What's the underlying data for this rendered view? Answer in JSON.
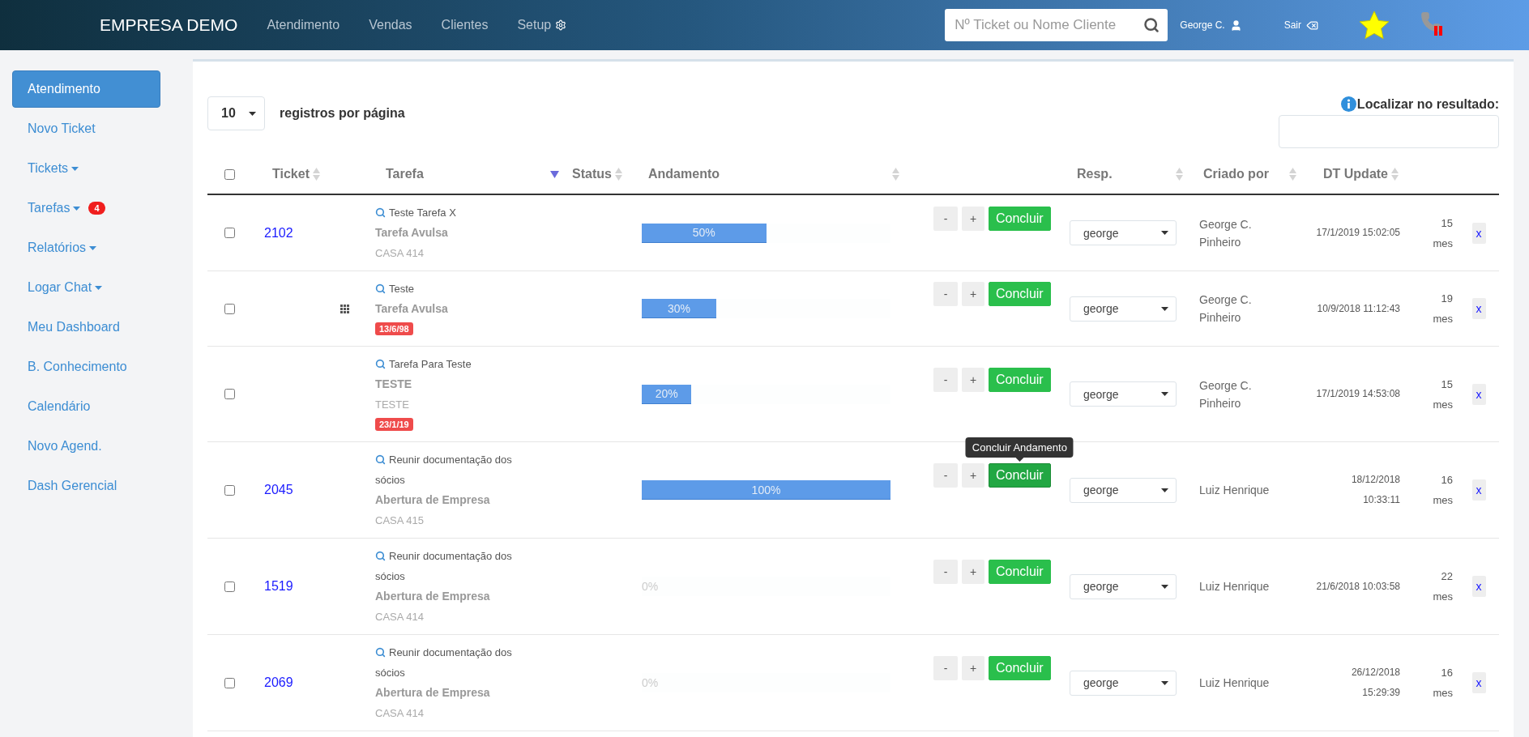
{
  "header": {
    "brand": "EMPRESA DEMO",
    "nav": [
      {
        "label": "Atendimento",
        "kind": "link"
      },
      {
        "label": "Vendas",
        "kind": "link"
      },
      {
        "label": "Clientes",
        "kind": "link"
      },
      {
        "label": "Setup",
        "kind": "settings"
      }
    ],
    "search": {
      "placeholder": "Nº Ticket ou Nome Cliente"
    },
    "user": "George C.",
    "logout": "Sair"
  },
  "sidebar": {
    "items": [
      {
        "label": "Atendimento",
        "selected": true,
        "dropdown": false
      },
      {
        "label": "Novo Ticket",
        "selected": false,
        "dropdown": false
      },
      {
        "label": "Tickets",
        "selected": false,
        "dropdown": true
      },
      {
        "label": "Tarefas",
        "selected": false,
        "dropdown": true,
        "badge": "4"
      },
      {
        "label": "Relatórios",
        "selected": false,
        "dropdown": true
      },
      {
        "label": "Logar Chat",
        "selected": false,
        "dropdown": true
      },
      {
        "label": "Meu Dashboard",
        "selected": false,
        "dropdown": false
      },
      {
        "label": "B. Conhecimento",
        "selected": false,
        "dropdown": false
      },
      {
        "label": "Calendário",
        "selected": false,
        "dropdown": false
      },
      {
        "label": "Novo Agend.",
        "selected": false,
        "dropdown": false
      },
      {
        "label": "Dash Gerencial",
        "selected": false,
        "dropdown": false
      }
    ]
  },
  "toolbar": {
    "page_size": "10",
    "page_size_label": "registros por página",
    "search_label": "Localizar no resultado:"
  },
  "table": {
    "columns": [
      {
        "kind": "checkbox",
        "checked": false
      },
      {
        "kind": "text",
        "label": "Ticket",
        "sorted": false
      },
      {
        "kind": "text",
        "label": "Tarefa",
        "sorted": true
      },
      {
        "kind": "text",
        "label": "Status",
        "sorted": false
      },
      {
        "kind": "text",
        "label": "Andamento",
        "sorted": false
      },
      {
        "kind": "text",
        "label": "Resp.",
        "sorted": false
      },
      {
        "kind": "text",
        "label": "Criado por",
        "sorted": false
      },
      {
        "kind": "text",
        "label": "DT Update",
        "sorted": false
      }
    ],
    "rows": [
      {
        "checked": false,
        "ticket": "2102",
        "menu": false,
        "task": {
          "title": "Teste Tarefa X",
          "type": "Tarefa Avulsa",
          "detail": "CASA 414"
        },
        "level": 0.5,
        "progress": "50%",
        "actions": [
          {
            "kind": "minus",
            "label": "-"
          },
          {
            "kind": "plus",
            "label": "+"
          },
          {
            "kind": "done",
            "label": "Concluir"
          }
        ],
        "resp": "george",
        "created_by": "George C. Pinheiro",
        "dt_update": [
          "17/1/2019 15:02:05"
        ],
        "age": "15 mes",
        "remove": "x"
      },
      {
        "checked": false,
        "menu": true,
        "task": {
          "title": "Teste",
          "type": "Tarefa Avulsa",
          "badge": "13/6/98"
        },
        "level": 0.3,
        "progress": "30%",
        "actions": [
          {
            "kind": "minus",
            "label": "-"
          },
          {
            "kind": "plus",
            "label": "+"
          },
          {
            "kind": "done",
            "label": "Concluir"
          }
        ],
        "resp": "george",
        "created_by": "George C. Pinheiro",
        "dt_update": [
          "10/9/2018 11:12:43"
        ],
        "age": "19 mes",
        "remove": "x"
      },
      {
        "checked": false,
        "menu": false,
        "task": {
          "title": "Tarefa Para Teste",
          "type": "TESTE",
          "detail": "TESTE",
          "badge": "23/1/19"
        },
        "level": 0.2,
        "progress": "20%",
        "actions": [
          {
            "kind": "minus",
            "label": "-"
          },
          {
            "kind": "plus",
            "label": "+"
          },
          {
            "kind": "done",
            "label": "Concluir"
          }
        ],
        "resp": "george",
        "created_by": "George C. Pinheiro",
        "dt_update": [
          "17/1/2019 14:53:08"
        ],
        "age": "15 mes",
        "remove": "x"
      },
      {
        "checked": false,
        "ticket": "2045",
        "menu": false,
        "task": {
          "title": "Reunir documentação dos sócios",
          "type": "Abertura de Empresa",
          "detail": "CASA 415"
        },
        "level": 1,
        "progress": "100%",
        "actions": [
          {
            "kind": "minus",
            "label": "-"
          },
          {
            "kind": "plus",
            "label": "+"
          },
          {
            "kind": "done",
            "label": "Concluir",
            "tooltip": "Concluir Andamento"
          }
        ],
        "resp": "george",
        "created_by": "Luiz Henrique",
        "dt_update": [
          "18/12/2018",
          "10:33:11"
        ],
        "age": "16 mes",
        "remove": "x"
      },
      {
        "checked": false,
        "ticket": "1519",
        "menu": false,
        "task": {
          "title": "Reunir documentação dos sócios",
          "type": "Abertura de Empresa",
          "detail": "CASA 414"
        },
        "level": 0,
        "progress": "0%",
        "actions": [
          {
            "kind": "minus",
            "label": "-"
          },
          {
            "kind": "plus",
            "label": "+"
          },
          {
            "kind": "done",
            "label": "Concluir"
          }
        ],
        "resp": "george",
        "created_by": "Luiz Henrique",
        "dt_update": [
          "21/6/2018 10:03:58"
        ],
        "age": "22 mes",
        "remove": "x"
      },
      {
        "checked": false,
        "ticket": "2069",
        "menu": false,
        "task": {
          "title": "Reunir documentação dos sócios",
          "type": "Abertura de Empresa",
          "detail": "CASA 414"
        },
        "level": 0,
        "progress": "0%",
        "actions": [
          {
            "kind": "minus",
            "label": "-"
          },
          {
            "kind": "plus",
            "label": "+"
          },
          {
            "kind": "done",
            "label": "Concluir"
          }
        ],
        "resp": "george",
        "created_by": "Luiz Henrique",
        "dt_update": [
          "26/12/2018",
          "15:29:39"
        ],
        "age": "16 mes",
        "remove": "x"
      }
    ]
  }
}
